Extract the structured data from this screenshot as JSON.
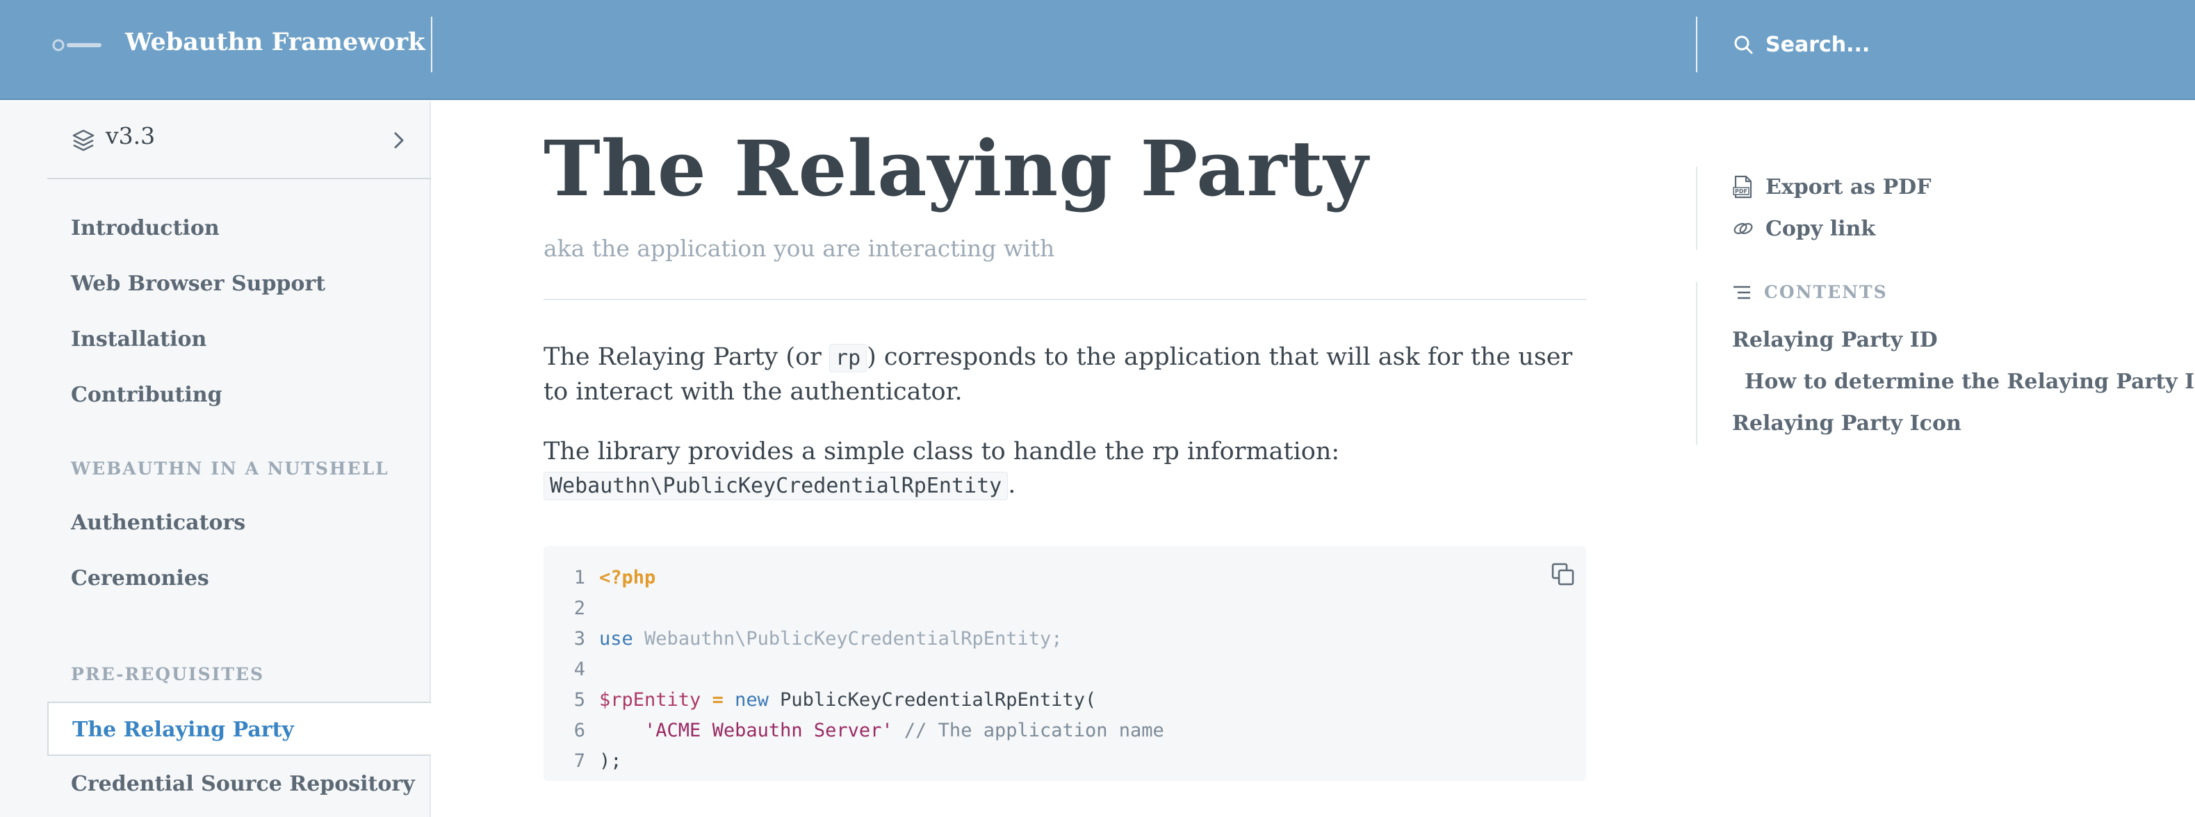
{
  "header": {
    "brand": "Webauthn Framework",
    "search_placeholder": "Search..."
  },
  "sidebar": {
    "version": "v3.3",
    "items": [
      {
        "label": "Introduction"
      },
      {
        "label": "Web Browser Support"
      },
      {
        "label": "Installation"
      },
      {
        "label": "Contributing"
      }
    ],
    "section_nutshell": "WEBAUTHN IN A NUTSHELL",
    "nutshell_items": [
      {
        "label": "Authenticators"
      },
      {
        "label": "Ceremonies"
      }
    ],
    "section_prereq": "PRE-REQUISITES",
    "prereq_items": [
      {
        "label": "The Relaying Party"
      },
      {
        "label": "Credential Source Repository"
      }
    ]
  },
  "main": {
    "title": "The Relaying Party",
    "subtitle": "aka the application you are interacting with",
    "para1_pre": "The Relaying Party (or ",
    "para1_code": "rp",
    "para1_post": ") corresponds to the application that will ask for the user to interact with the authenticator.",
    "para2_pre": "The library provides a simple class to handle the rp information: ",
    "para2_code": "Webauthn\\PublicKeyCredentialRpEntity",
    "para2_post": ".",
    "code": {
      "line_numbers": [
        "1",
        "2",
        "3",
        "4",
        "5",
        "6",
        "7"
      ],
      "php_open": "<?php",
      "use_kw": "use",
      "use_ns": "Webauthn\\PublicKeyCredentialRpEntity;",
      "var": "$rpEntity",
      "assign": " = ",
      "new_kw": "new",
      "class_call": " PublicKeyCredentialRpEntity(",
      "indent": "    ",
      "string": "'ACME Webauthn Server'",
      "comment": " // The application name",
      "close": ");"
    }
  },
  "rail": {
    "export_pdf": "Export as PDF",
    "copy_link": "Copy link",
    "contents_title": "CONTENTS",
    "toc": [
      {
        "label": "Relaying Party ID"
      },
      {
        "label": "How to determine the Relaying Party ID?"
      },
      {
        "label": "Relaying Party Icon"
      }
    ]
  },
  "colors": {
    "header_bg": "#6fa1c8",
    "accent": "#3884c5",
    "sidebar_bg": "#f5f7f9"
  },
  "icons": [
    "brand-logo",
    "search-icon",
    "layers-icon",
    "chevron-right-icon",
    "copy-icon",
    "pdf-icon",
    "link-icon",
    "contents-icon"
  ]
}
